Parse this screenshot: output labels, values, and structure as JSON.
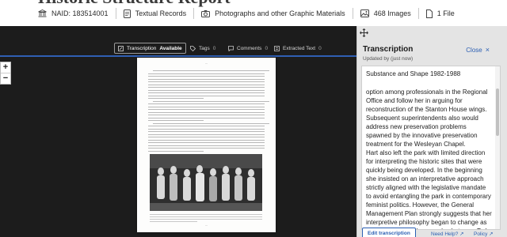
{
  "record": {
    "title": "Historic Structure Report",
    "naid": "NAID: 183514001",
    "type": "Textual Records",
    "category": "Photographs and other Graphic Materials",
    "images": "468 Images",
    "files": "1 File"
  },
  "viewer": {
    "tabs": {
      "transcription": {
        "label": "Transcription",
        "status": "Available"
      },
      "tags": {
        "label": "Tags",
        "count": "0"
      },
      "comments": {
        "label": "Comments",
        "count": "0"
      },
      "extracted": {
        "label": "Extracted Text",
        "count": "0"
      }
    },
    "zoom": {
      "in": "+",
      "out": "−"
    }
  },
  "panel": {
    "title": "Transcription",
    "close_label": "Close",
    "updated": "Updated by (just now)",
    "heading": "Substance and Shape 1982-1988",
    "paragraphs": [
      "option among professionals in the Regional Office and follow her in arguing for reconstruction of the Stanton House wings. Subsequent superintendents also would address new preservation problems spawned by the innovative preservation treatment for the Wesleyan Chapel.",
      "Hart also left the park with limited direction for interpreting the historic sites that were quickly being developed. In the beginning she insisted on an interpretative approach strictly aligned with the legislative mandate to avoid entangling the park in contemporary feminist politics. However, the General Management Plan strongly suggests that her interpretive philosophy began to change as the park took no shape and substance. To be sure, Hart had"
    ],
    "edit_button": "Edit transcription",
    "help_link": "Need Help?",
    "policy_link": "Policy"
  },
  "colors": {
    "accent": "#2b5fb3",
    "viewer_bg": "#1c1c1c",
    "panel_bg": "#e4e4e4"
  }
}
